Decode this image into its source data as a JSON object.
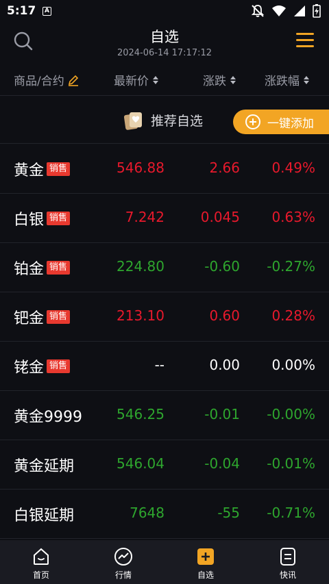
{
  "status_bar": {
    "time": "5:17",
    "notification_letter": "A"
  },
  "header": {
    "title": "自选",
    "datetime": "2024-06-14 17:17:12"
  },
  "columns": {
    "name": "商品/合约",
    "price": "最新价",
    "change": "涨跌",
    "percent": "涨跌幅"
  },
  "recommend": {
    "label": "推荐自选",
    "add_button": "一键添加"
  },
  "rows": [
    {
      "name": "黄金",
      "badge": "销售",
      "price": "546.88",
      "change": "2.66",
      "percent": "0.49%",
      "trend": "up"
    },
    {
      "name": "白银",
      "badge": "销售",
      "price": "7.242",
      "change": "0.045",
      "percent": "0.63%",
      "trend": "up"
    },
    {
      "name": "铂金",
      "badge": "销售",
      "price": "224.80",
      "change": "-0.60",
      "percent": "-0.27%",
      "trend": "down"
    },
    {
      "name": "钯金",
      "badge": "销售",
      "price": "213.10",
      "change": "0.60",
      "percent": "0.28%",
      "trend": "up"
    },
    {
      "name": "铑金",
      "badge": "销售",
      "price": "--",
      "change": "0.00",
      "percent": "0.00%",
      "trend": "flat"
    },
    {
      "name": "黄金9999",
      "badge": "",
      "price": "546.25",
      "change": "-0.01",
      "percent": "-0.00%",
      "trend": "down"
    },
    {
      "name": "黄金延期",
      "badge": "",
      "price": "546.04",
      "change": "-0.04",
      "percent": "-0.01%",
      "trend": "down"
    },
    {
      "name": "白银延期",
      "badge": "",
      "price": "7648",
      "change": "-55",
      "percent": "-0.71%",
      "trend": "down"
    }
  ],
  "bottom_nav": [
    {
      "label": "首页",
      "icon": "home-icon"
    },
    {
      "label": "行情",
      "icon": "market-icon"
    },
    {
      "label": "自选",
      "icon": "watchlist-icon"
    },
    {
      "label": "快讯",
      "icon": "news-icon"
    }
  ],
  "colors": {
    "accent": "#f2a524",
    "up": "#e8192c",
    "down": "#2ea62e",
    "badge": "#e8392f",
    "background": "#0e0f14"
  }
}
